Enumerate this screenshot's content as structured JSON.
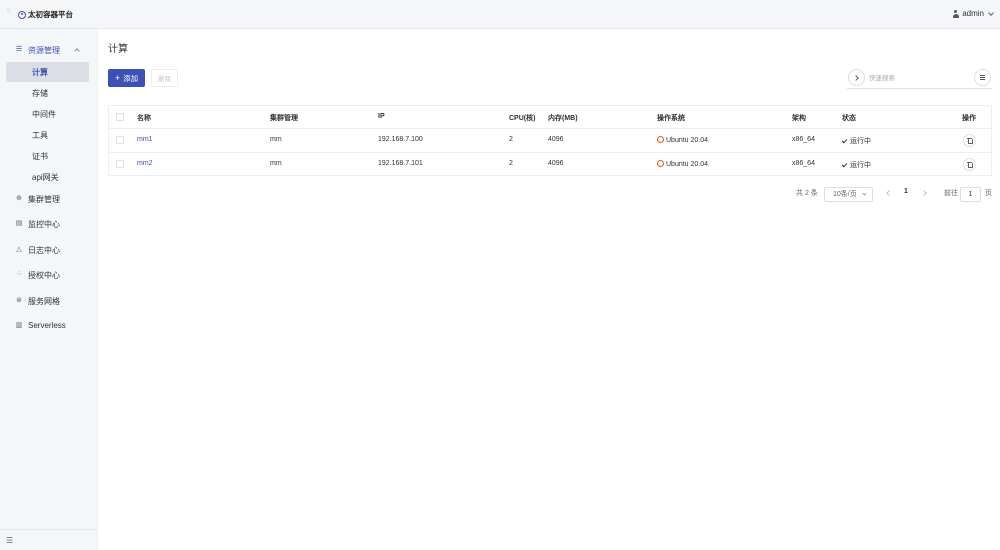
{
  "header": {
    "app_title": "太初容器平台",
    "user": "admin"
  },
  "sidebar": {
    "groups": [
      {
        "label": "资源管理",
        "icon": "sliders-icon"
      },
      {
        "label": "集群管理",
        "icon": "cluster-icon"
      },
      {
        "label": "监控中心",
        "icon": "monitor-icon"
      },
      {
        "label": "日志中心",
        "icon": "bell-icon"
      },
      {
        "label": "授权中心",
        "icon": "grid-icon"
      },
      {
        "label": "服务网格",
        "icon": "mesh-icon"
      },
      {
        "label": "Serverless",
        "icon": "doc-icon"
      }
    ],
    "sub_items": [
      "计算",
      "存储",
      "中间件",
      "工具",
      "证书",
      "api网关"
    ]
  },
  "main": {
    "title": "计算",
    "add_label": "添加",
    "delete_label": "删除",
    "search_placeholder": "快速搜索"
  },
  "table": {
    "columns": [
      "名称",
      "集群管理",
      "IP",
      "CPU(核)",
      "内存(MB)",
      "操作系统",
      "架构",
      "状态",
      "操作"
    ],
    "rows": [
      {
        "name": "mm1",
        "cluster": "mm",
        "ip": "192.168.7.100",
        "cpu": "2",
        "mem": "4096",
        "os": "Ubuntu 20.04",
        "arch": "x86_64",
        "status": "运行中"
      },
      {
        "name": "mm2",
        "cluster": "mm",
        "ip": "192.168.7.101",
        "cpu": "2",
        "mem": "4096",
        "os": "Ubuntu 20.04",
        "arch": "x86_64",
        "status": "运行中"
      }
    ]
  },
  "pagination": {
    "total": "共 2 条",
    "page_size": "10条/页",
    "current": "1",
    "goto_prefix": "前往",
    "goto_value": "1",
    "goto_suffix": "页"
  },
  "colors": {
    "accent": "#3d50b7",
    "ubuntu": "#e95420"
  }
}
